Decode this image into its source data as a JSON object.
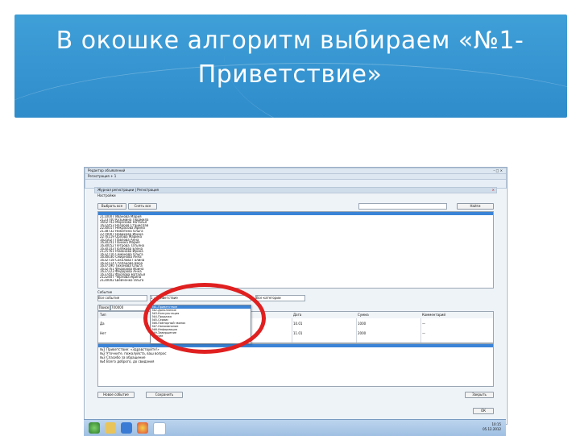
{
  "slide": {
    "title_line1": "В окошке алгоритм выбираем «№1-",
    "title_line2": "Приветствие»"
  },
  "app": {
    "window_title": "Редактор объявлений",
    "toolbar_text": "Регистрация + 1",
    "doc_tab": "Журнал регистрации | Регистрация",
    "section_label": "Настройки",
    "btn_select_all": "Выбрать все",
    "btn_clear_all": "Снять все",
    "btn_search": "Найти",
    "list_items": [
      "2110007 Иванова Мария",
      "2123740 Кузьмина Людмила",
      "1602743 Морозова Наталья",
      "1622453 Назаров Станислав",
      "2230017 Некрасова Ирина",
      "2138732 Никитина Ольга",
      "2274007 Новикова Ирина",
      "2276119 Орлова Марина",
      "1625027 Павлова Анна",
      "1630241 Панина Мария",
      "1630052 Петрова Татьяна",
      "1630143 Полякова Елена",
      "2125761 Романова Ирина",
      "1632716 Семенова Ольга",
      "1630030 Смирнова Анна",
      "1632718 Соколова Галина",
      "1632114 Степанова Вера",
      "1637190 Тихонова Ольга",
      "1632761 Федорова Ирина",
      "1637223 Федорова Анна",
      "1637402 Фролова Наталья",
      "2122407 Чернова Ирина",
      "2120002 Шевченко Ольга"
    ],
    "filter_label": "Событие",
    "filter_select_1": "Все события",
    "filter_select_2": "1 - Приветствие",
    "filter_select_3": "Все категории",
    "btn_find": "Поиск",
    "search_value": "700000",
    "dropdown_items": [
      "№1-Приветствие",
      "№2-Дополнение",
      "№3-Консультация",
      "№4-Продажа",
      "№5-Сервис",
      "№6-Повторный звонок",
      "№7-Напоминание",
      "№8-Информация",
      "№9-Завершение",
      "Прочее"
    ],
    "grid_headers": [
      "Тип",
      "Фамилия",
      "Статус",
      "Дата",
      "Сумма",
      "Комментарий"
    ],
    "grid_rows": [
      [
        "Да",
        "Иванова",
        "Новое",
        "10.01",
        "1000",
        "—"
      ],
      [
        "Нет",
        "Петрова",
        "Повтор",
        "11.01",
        "2000",
        "—"
      ]
    ],
    "log_lines": [
      "№1 Приветствие: «Здравствуйте!»",
      "№2 Уточните, пожалуйста, ваш вопрос",
      "№3 Спасибо за обращение",
      "№4 Всего доброго, до свидания"
    ],
    "btn_bottom_1": "Новое событие",
    "btn_bottom_2": "Сохранить",
    "btn_bottom_3": "Закрыть",
    "btn_ok": "ОК",
    "clock_time": "10:15",
    "clock_date": "05.12.2012"
  },
  "colors": {
    "banner": "#2f8ccb",
    "highlight": "#e02020",
    "selection": "#3a83d6"
  }
}
